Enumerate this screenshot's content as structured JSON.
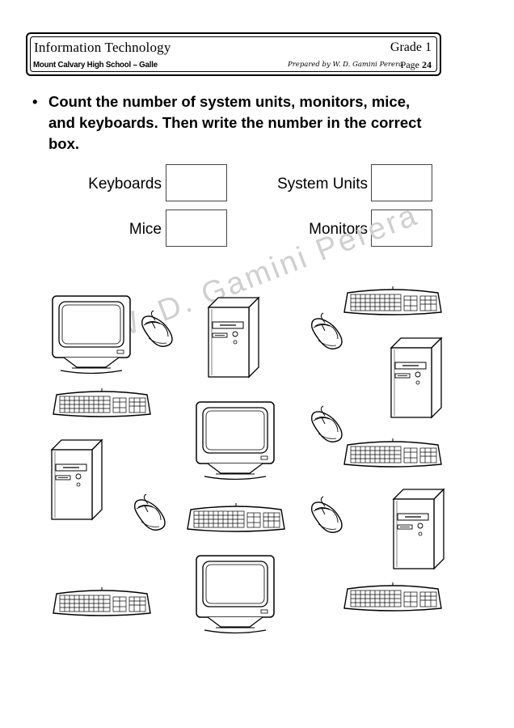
{
  "header": {
    "subject": "Information Technology",
    "grade": "Grade 1",
    "school": "Mount Calvary High School – Galle",
    "prepared_by": "Prepared by W. D. Gamini Perera",
    "page_label": "Page",
    "page_number": "24"
  },
  "instruction": {
    "bullet": "•",
    "text": "Count the number of system units, monitors, mice, and keyboards. Then write the number in the correct box."
  },
  "answers": {
    "keyboards_label": "Keyboards",
    "system_units_label": "System Units",
    "mice_label": "Mice",
    "monitors_label": "Monitors"
  },
  "watermark": "W. D. Gamini Perera"
}
